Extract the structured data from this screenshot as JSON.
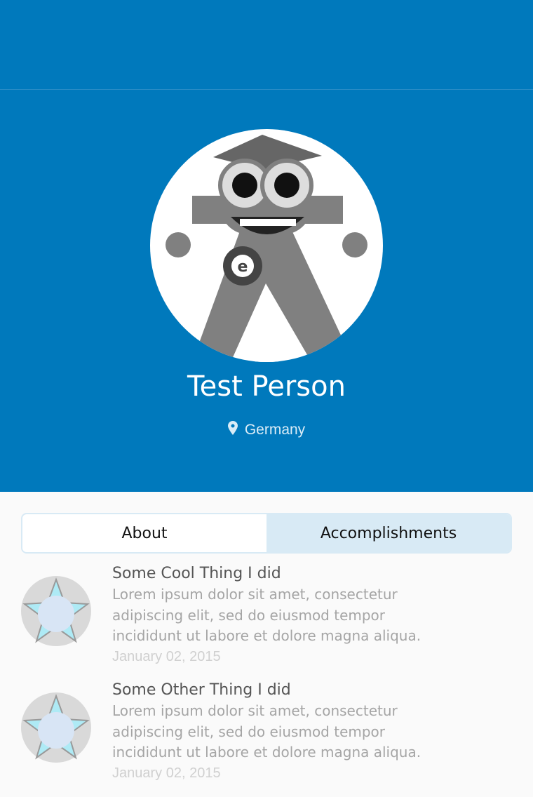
{
  "profile": {
    "name": "Test Person",
    "location": "Germany"
  },
  "tabs": [
    {
      "label": "About",
      "active": false
    },
    {
      "label": "Accomplishments",
      "active": true
    }
  ],
  "accomplishments": [
    {
      "title": "Some Cool Thing I did",
      "description": "Lorem ipsum dolor sit amet, consectetur adipiscing elit, sed do eiusmod tempor incididunt ut labore et dolore magna aliqua.",
      "date": "January 02, 2015"
    },
    {
      "title": "Some Other Thing I did",
      "description": "Lorem ipsum dolor sit amet, consectetur adipiscing elit, sed do eiusmod tempor incididunt ut labore et dolore magna aliqua.",
      "date": "January 02, 2015"
    }
  ],
  "colors": {
    "brand": "#0079bc",
    "tab_active": "#d8eaf5"
  }
}
